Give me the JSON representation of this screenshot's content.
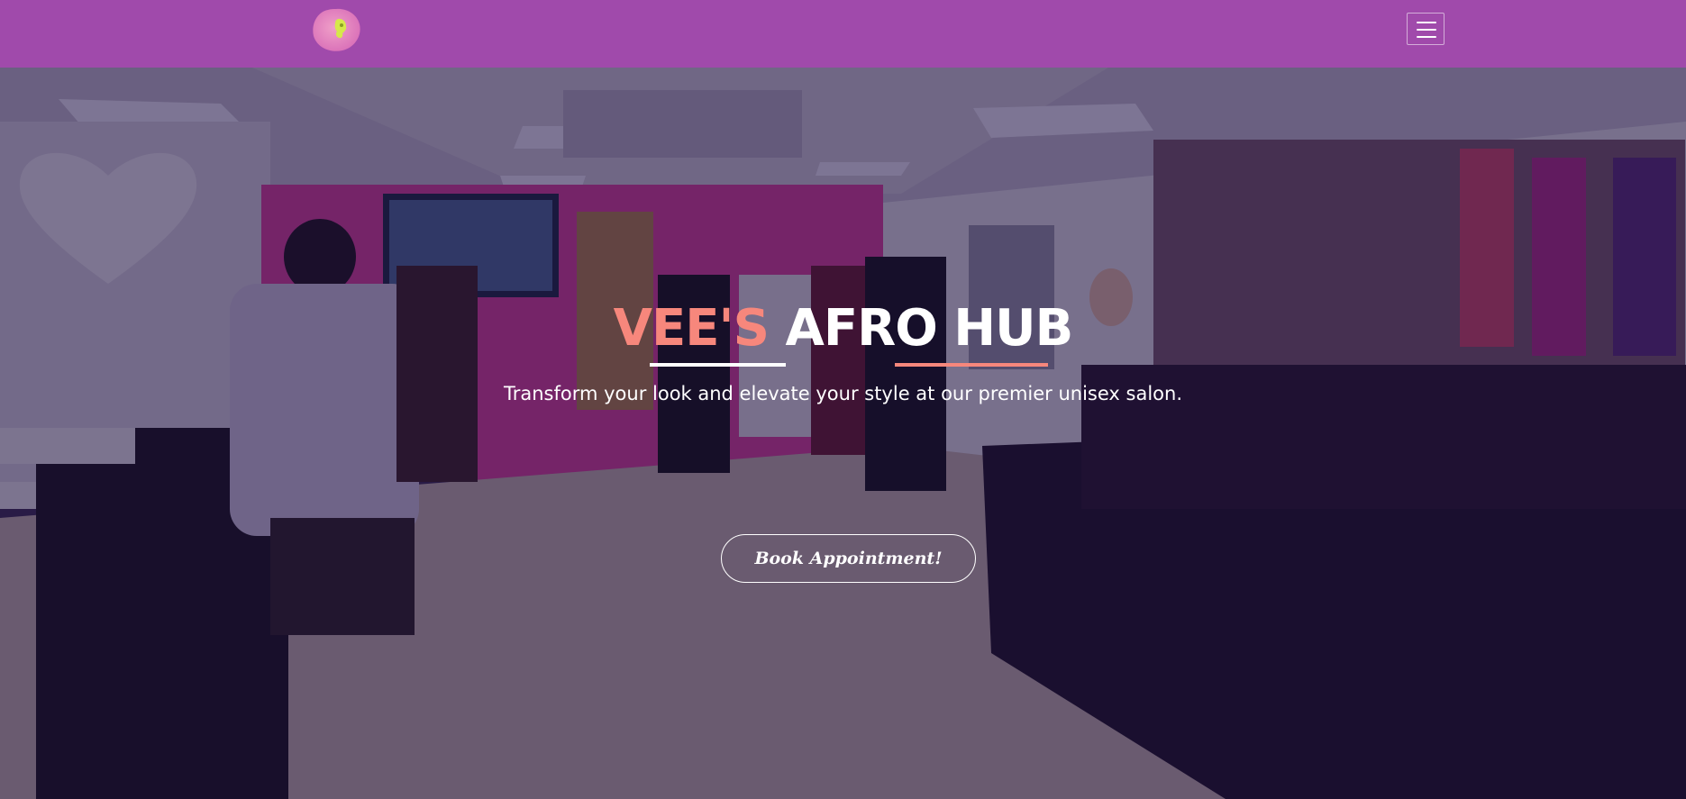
{
  "navbar": {
    "background": "#a04aab",
    "logo_icon": "afro-silhouette-logo",
    "menu_icon": "hamburger-menu-icon"
  },
  "hero": {
    "title_accent": "VEE'S",
    "title_main": "AFRO HUB",
    "accent_color": "#f7877c",
    "subtitle": "Transform your look and elevate your style at our premier unisex salon.",
    "cta_label": "Book Appointment!",
    "background_description_icon": "salon-interior-photo"
  }
}
